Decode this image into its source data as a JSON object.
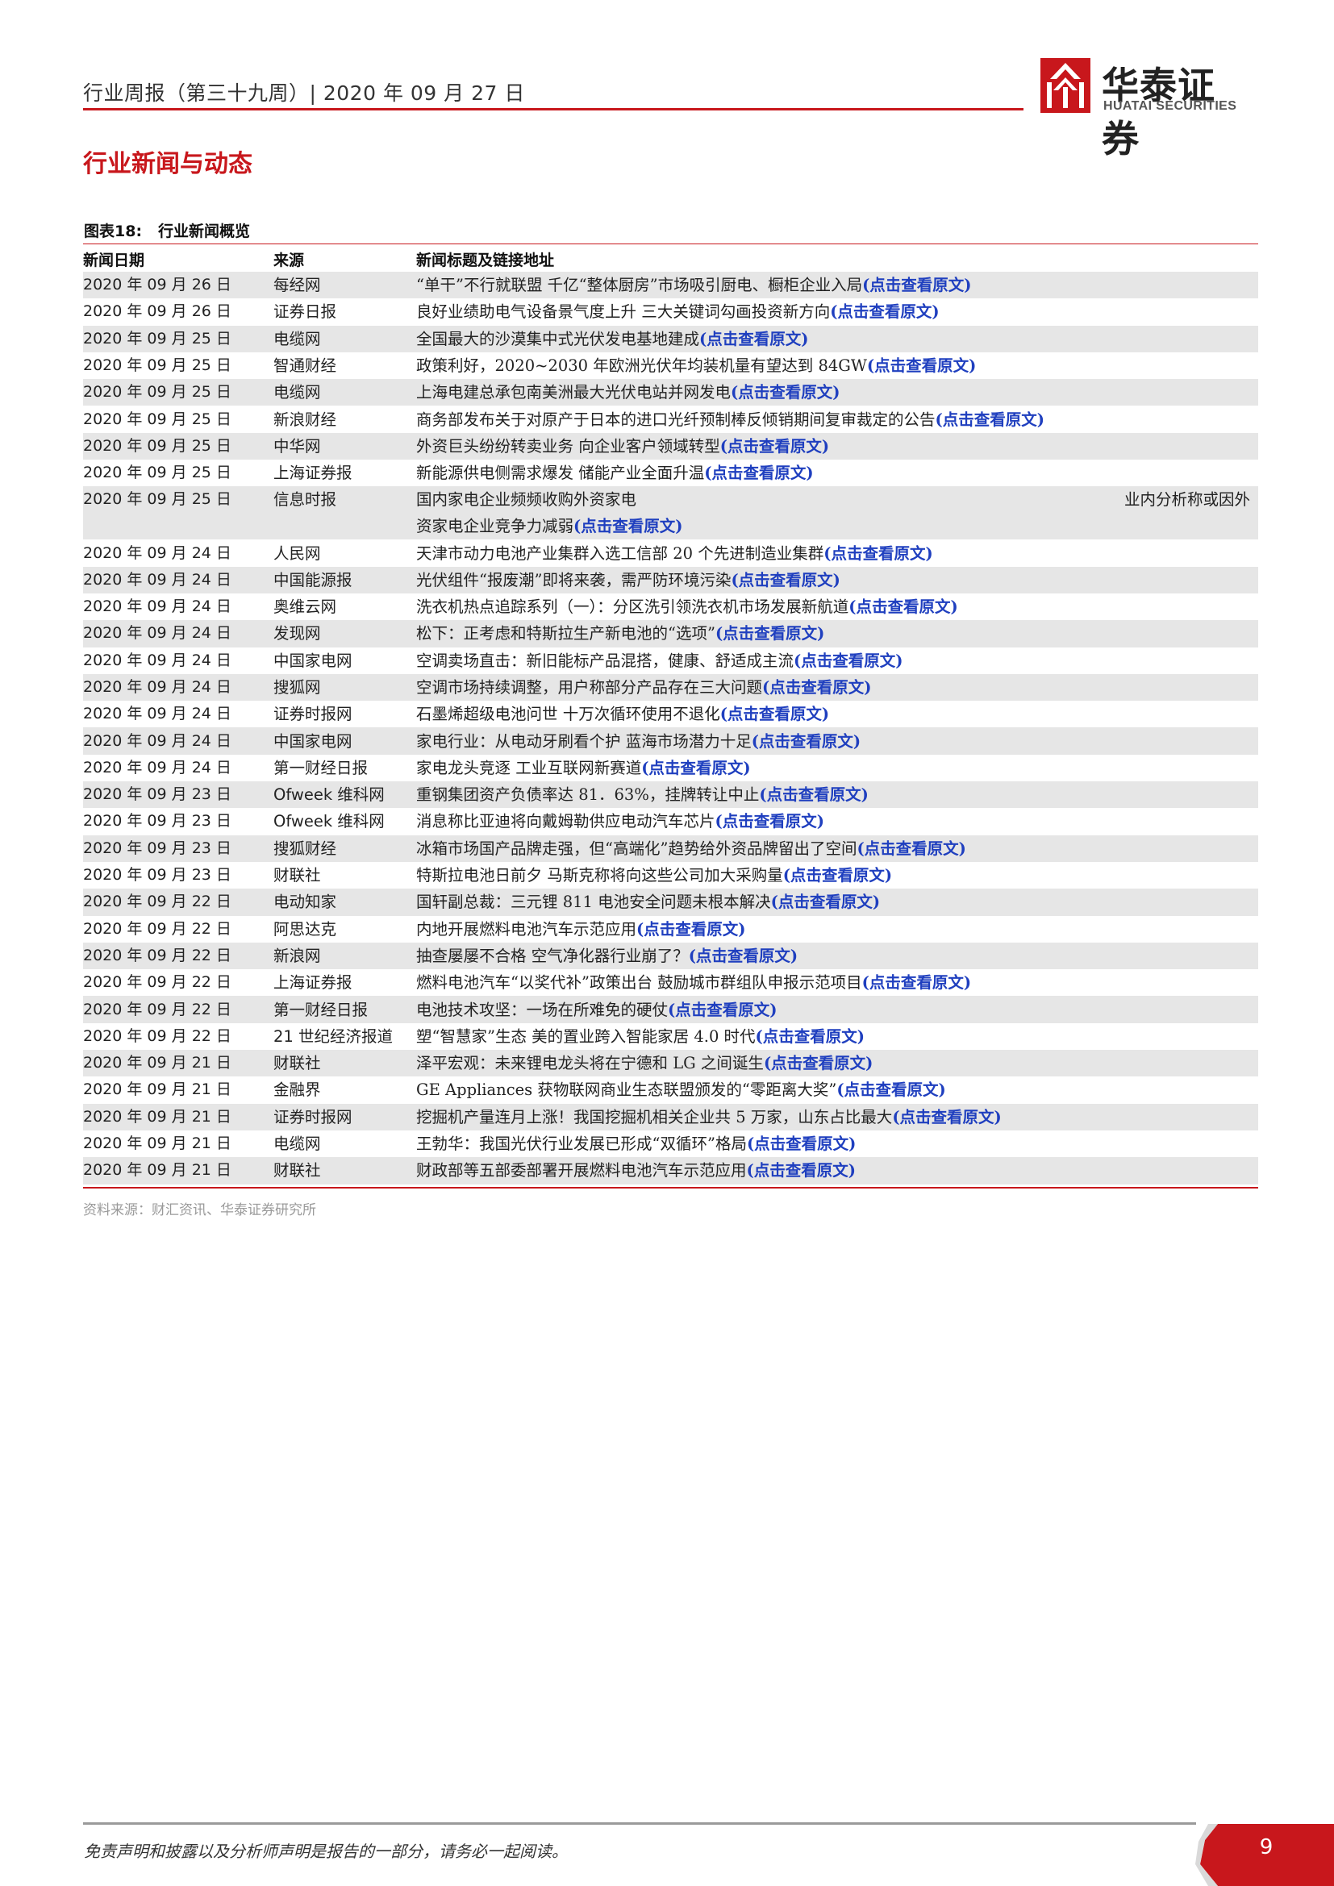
{
  "header": {
    "title": "行业周报（第三十九周）| 2020 年 09 月 27 日",
    "logo_cn": "华泰证券",
    "logo_en": "HUATAI SECURITIES",
    "brand_color": "#c8171c"
  },
  "section_title": "行业新闻与动态",
  "figure": {
    "number": "图表18:",
    "title": "行业新闻概览"
  },
  "table": {
    "columns": [
      "新闻日期",
      "来源",
      "新闻标题及链接地址"
    ],
    "link_label": "(点击查看原文)",
    "link_color": "#1f3fbf",
    "rows": [
      {
        "date": "2020 年 09 月 26 日",
        "source": "每经网",
        "title": "“单干”不行就联盟  千亿“整体厨房”市场吸引厨电、橱柜企业入局"
      },
      {
        "date": "2020 年 09 月 26 日",
        "source": "证券日报",
        "title": "良好业绩助电气设备景气度上升 三大关键词勾画投资新方向"
      },
      {
        "date": "2020 年 09 月 25 日",
        "source": "电缆网",
        "title": "全国最大的沙漠集中式光伏发电基地建成"
      },
      {
        "date": "2020 年 09 月 25 日",
        "source": "智通财经",
        "title": "政策利好，2020~2030 年欧洲光伏年均装机量有望达到 84GW"
      },
      {
        "date": "2020 年 09 月 25 日",
        "source": "电缆网",
        "title": "上海电建总承包南美洲最大光伏电站并网发电"
      },
      {
        "date": "2020 年 09 月 25 日",
        "source": "新浪财经",
        "title": "商务部发布关于对原产于日本的进口光纤预制棒反倾销期间复审裁定的公告"
      },
      {
        "date": "2020 年 09 月 25 日",
        "source": "中华网",
        "title": "外资巨头纷纷转卖业务 向企业客户领域转型"
      },
      {
        "date": "2020 年 09 月 25 日",
        "source": "上海证券报",
        "title": "新能源供电侧需求爆发 储能产业全面升温"
      },
      {
        "date": "2020 年 09 月 25 日",
        "source": "信息时报",
        "title": "国内家电企业频频收购外资家电",
        "title_right": "业内分析称或因外",
        "title_cont": "资家电企业竞争力减弱"
      },
      {
        "date": "2020 年 09 月 24 日",
        "source": "人民网",
        "title": "天津市动力电池产业集群入选工信部 20 个先进制造业集群"
      },
      {
        "date": "2020 年 09 月 24 日",
        "source": "中国能源报",
        "title": "光伏组件“报废潮”即将来袭，需严防环境污染"
      },
      {
        "date": "2020 年 09 月 24 日",
        "source": "奥维云网",
        "title": "洗衣机热点追踪系列（一）：分区洗引领洗衣机市场发展新航道"
      },
      {
        "date": "2020 年 09 月 24 日",
        "source": "发现网",
        "title": "松下：正考虑和特斯拉生产新电池的“选项”"
      },
      {
        "date": "2020 年 09 月 24 日",
        "source": "中国家电网",
        "title": "空调卖场直击：新旧能标产品混搭，健康、舒适成主流"
      },
      {
        "date": "2020 年 09 月 24 日",
        "source": "搜狐网",
        "title": "空调市场持续调整，用户称部分产品存在三大问题"
      },
      {
        "date": "2020 年 09 月 24 日",
        "source": "证券时报网",
        "title": "石墨烯超级电池问世 十万次循环使用不退化"
      },
      {
        "date": "2020 年 09 月 24 日",
        "source": "中国家电网",
        "title": "家电行业：从电动牙刷看个护 蓝海市场潜力十足"
      },
      {
        "date": "2020 年 09 月 24 日",
        "source": "第一财经日报",
        "title": "家电龙头竞逐 工业互联网新赛道"
      },
      {
        "date": "2020 年 09 月 23 日",
        "source": "Ofweek 维科网",
        "title": "重钢集团资产负债率达 81．63%，挂牌转让中止"
      },
      {
        "date": "2020 年 09 月 23 日",
        "source": "Ofweek 维科网",
        "title": "消息称比亚迪将向戴姆勒供应电动汽车芯片"
      },
      {
        "date": "2020 年 09 月 23 日",
        "source": "搜狐财经",
        "title": "冰箱市场国产品牌走强，但“高端化”趋势给外资品牌留出了空间"
      },
      {
        "date": "2020 年 09 月 23 日",
        "source": "财联社",
        "title": "特斯拉电池日前夕 马斯克称将向这些公司加大采购量"
      },
      {
        "date": "2020 年 09 月 22 日",
        "source": "电动知家",
        "title": "国轩副总裁：三元锂 811 电池安全问题未根本解决"
      },
      {
        "date": "2020 年 09 月 22 日",
        "source": "阿思达克",
        "title": "内地开展燃料电池汽车示范应用"
      },
      {
        "date": "2020 年 09 月 22 日",
        "source": "新浪网",
        "title": "抽查屡屡不合格 空气净化器行业崩了？"
      },
      {
        "date": "2020 年 09 月 22 日",
        "source": "上海证券报",
        "title": "燃料电池汽车“以奖代补”政策出台 鼓励城市群组队申报示范项目"
      },
      {
        "date": "2020 年 09 月 22 日",
        "source": "第一财经日报",
        "title": "电池技术攻坚：一场在所难免的硬仗"
      },
      {
        "date": "2020 年 09 月 22 日",
        "source": "21 世纪经济报道",
        "title": "塑“智慧家”生态 美的置业跨入智能家居 4.0 时代"
      },
      {
        "date": "2020 年 09 月 21 日",
        "source": "财联社",
        "title": "泽平宏观：未来锂电龙头将在宁德和 LG 之间诞生"
      },
      {
        "date": "2020 年 09 月 21 日",
        "source": "金融界",
        "title": "GE Appliances 获物联网商业生态联盟颁发的“零距离大奖”"
      },
      {
        "date": "2020 年 09 月 21 日",
        "source": "证券时报网",
        "title": "挖掘机产量连月上涨！我国挖掘机相关企业共 5 万家，山东占比最大"
      },
      {
        "date": "2020 年 09 月 21 日",
        "source": "电缆网",
        "title": "王勃华：我国光伏行业发展已形成“双循环”格局"
      },
      {
        "date": "2020 年 09 月 21 日",
        "source": "财联社",
        "title": "财政部等五部委部署开展燃料电池汽车示范应用"
      }
    ]
  },
  "source_note": "资料来源：财汇资讯、华泰证券研究所",
  "footer": {
    "disclaimer": "免责声明和披露以及分析师声明是报告的一部分，请务必一起阅读。",
    "page_number": "9"
  }
}
